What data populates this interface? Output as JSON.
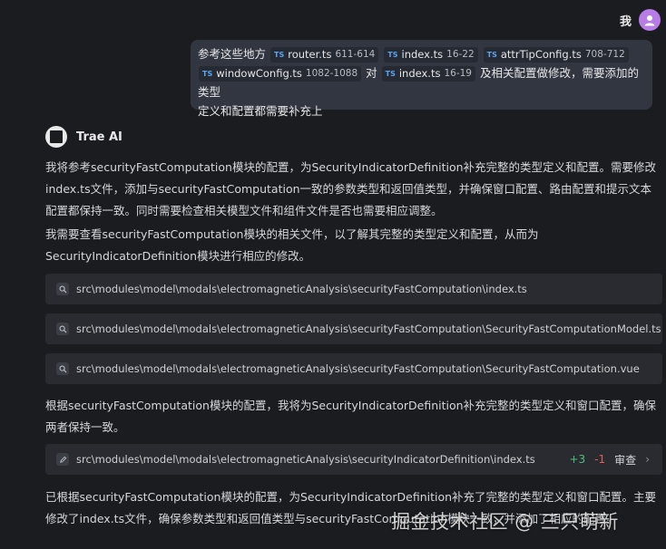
{
  "user": {
    "name": "我"
  },
  "message": {
    "prefix": "参考这些地方",
    "chips": [
      {
        "file": "router.ts",
        "range": "611-614"
      },
      {
        "file": "index.ts",
        "range": "16-22"
      },
      {
        "file": "attrTipConfig.ts",
        "range": "708-712"
      },
      {
        "file": "windowConfig.ts",
        "range": "1082-1088"
      },
      {
        "file": "index.ts",
        "range": "16-19"
      }
    ],
    "conj": "对",
    "tail1": "及相关配置做修改，需要添加的类型",
    "tail2": "定义和配置都需要补充上",
    "chip_tag": "TS"
  },
  "assistant": {
    "name": "Trae AI"
  },
  "paragraphs": {
    "p1": "我将参考securityFastComputation模块的配置，为SecurityIndicatorDefinition补充完整的类型定义和配置。需要修改index.ts文件，添加与securityFastComputation一致的参数类型和返回值类型，并确保窗口配置、路由配置和提示文本配置都保持一致。同时需要检查相关模型文件和组件文件是否也需要相应调整。",
    "p2": "我需要查看securityFastComputation模块的相关文件，以了解其完整的类型定义和配置，从而为SecurityIndicatorDefinition模块进行相应的修改。",
    "p3": "根据securityFastComputation模块的配置，我将为SecurityIndicatorDefinition补充完整的类型定义和窗口配置，确保两者保持一致。",
    "p4": "已根据securityFastComputation模块的配置，为SecurityIndicatorDefinition补充了完整的类型定义和窗口配置。主要修改了index.ts文件，确保参数类型和返回值类型与securityFastComputation模块一致，并添加了相应的配置。"
  },
  "search_results": [
    {
      "path": "src\\modules\\model\\modals\\electromagneticAnalysis\\securityFastComputation\\index.ts",
      "icon": "search-icon"
    },
    {
      "path": "src\\modules\\model\\modals\\electromagneticAnalysis\\securityFastComputation\\SecurityFastComputationModel.ts",
      "icon": "search-icon"
    },
    {
      "path": "src\\modules\\model\\modals\\electromagneticAnalysis\\securityFastComputation\\SecurityFastComputation.vue",
      "icon": "search-icon"
    }
  ],
  "edit_result": {
    "path": "src\\modules\\model\\modals\\electromagneticAnalysis\\securityIndicatorDefinition\\index.ts",
    "added": "+3",
    "removed": "-1",
    "review_label": "审查",
    "icon": "pencil-icon"
  },
  "watermark": "掘金技术社区 @ 三只萌新",
  "colors": {
    "plus": "#4fc07a",
    "minus": "#e05d5d",
    "ts_tag": "#5aa4f0",
    "avatar": "#b77ce6"
  }
}
